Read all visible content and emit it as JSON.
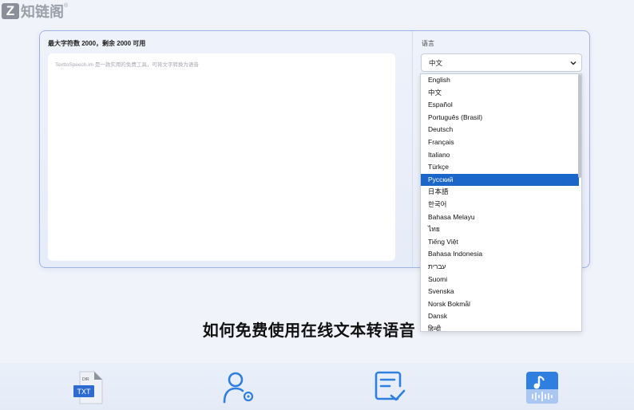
{
  "logo": {
    "mark": "Z",
    "text": "知链阁",
    "reg": "®"
  },
  "editor": {
    "limit_label": "最大字符数 2000，剩余 2000 可用",
    "placeholder": "TexttoSpeech.im 是一款实用的免费工具，可将文字转换为语音"
  },
  "language": {
    "label": "语言",
    "selected": "中文",
    "options": [
      "English",
      "中文",
      "Español",
      "Português (Brasil)",
      "Deutsch",
      "Français",
      "Italiano",
      "Türkçe",
      "Русский",
      "日本語",
      "한국어",
      "Bahasa Melayu",
      "ไทย",
      "Tiếng Việt",
      "Bahasa Indonesia",
      "עברית",
      "Suomi",
      "Svenska",
      "Norsk Bokmål",
      "Dansk",
      "हिन्दी"
    ],
    "highlighted": "Русский"
  },
  "section_heading": "如何免费使用在线文本转语音",
  "features": {
    "txt_badge": "TXT",
    "txt_tag": "DIR"
  },
  "colors": {
    "accent": "#1a66c9",
    "icon_blue": "#2f7fe0"
  }
}
